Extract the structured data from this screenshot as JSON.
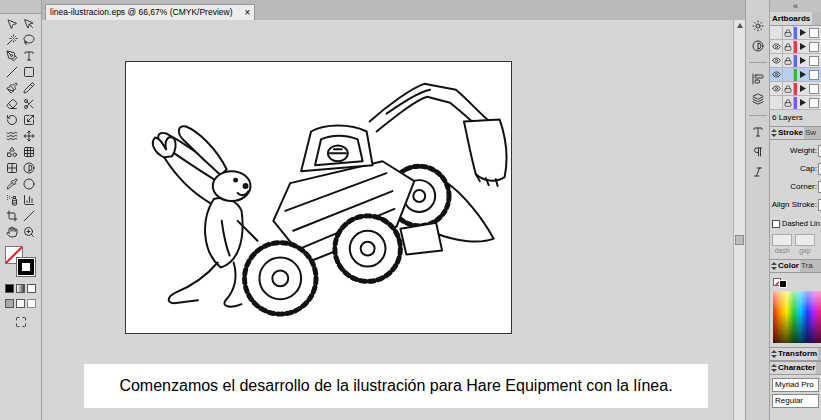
{
  "window": {
    "title": "linea-ilustracion.eps @ 66,67% (CMYK/Preview)",
    "close": "×"
  },
  "panel_collapse": "«",
  "layers_panel": {
    "tab": "Artboards",
    "count": "6 Layers",
    "layers": [
      {
        "visible": false,
        "locked": true,
        "selected": false,
        "color": "#4f6cf5"
      },
      {
        "visible": true,
        "locked": true,
        "selected": false,
        "color": "#e03c3c"
      },
      {
        "visible": true,
        "locked": true,
        "selected": false,
        "color": "#4f6cf5"
      },
      {
        "visible": true,
        "locked": false,
        "selected": true,
        "color": "#3cb43c"
      },
      {
        "visible": true,
        "locked": true,
        "selected": false,
        "color": "#e03c3c"
      },
      {
        "visible": false,
        "locked": true,
        "selected": false,
        "color": "#7a5af0"
      }
    ]
  },
  "stroke_panel": {
    "tabs": [
      {
        "label": "Stroke",
        "selected": true
      },
      {
        "label": "Sw",
        "selected": false
      }
    ],
    "fields": [
      "Weight:",
      "Cap:",
      "Corner:",
      "Align Stroke:"
    ],
    "dashed": {
      "label": "Dashed Lin",
      "checked": false
    },
    "dash_labels": [
      "dash",
      "gap"
    ]
  },
  "color_panel": {
    "tabs": [
      {
        "label": "Color",
        "selected": true
      },
      {
        "label": "Tra",
        "selected": false
      }
    ]
  },
  "transform_panel": {
    "tab": "Transform"
  },
  "character_panel": {
    "tab": "Character",
    "font": "Myriad Pro",
    "style": "Regular"
  },
  "caption": "Comenzamos el desarrollo de la ilustración para Hare Equipment con la línea."
}
